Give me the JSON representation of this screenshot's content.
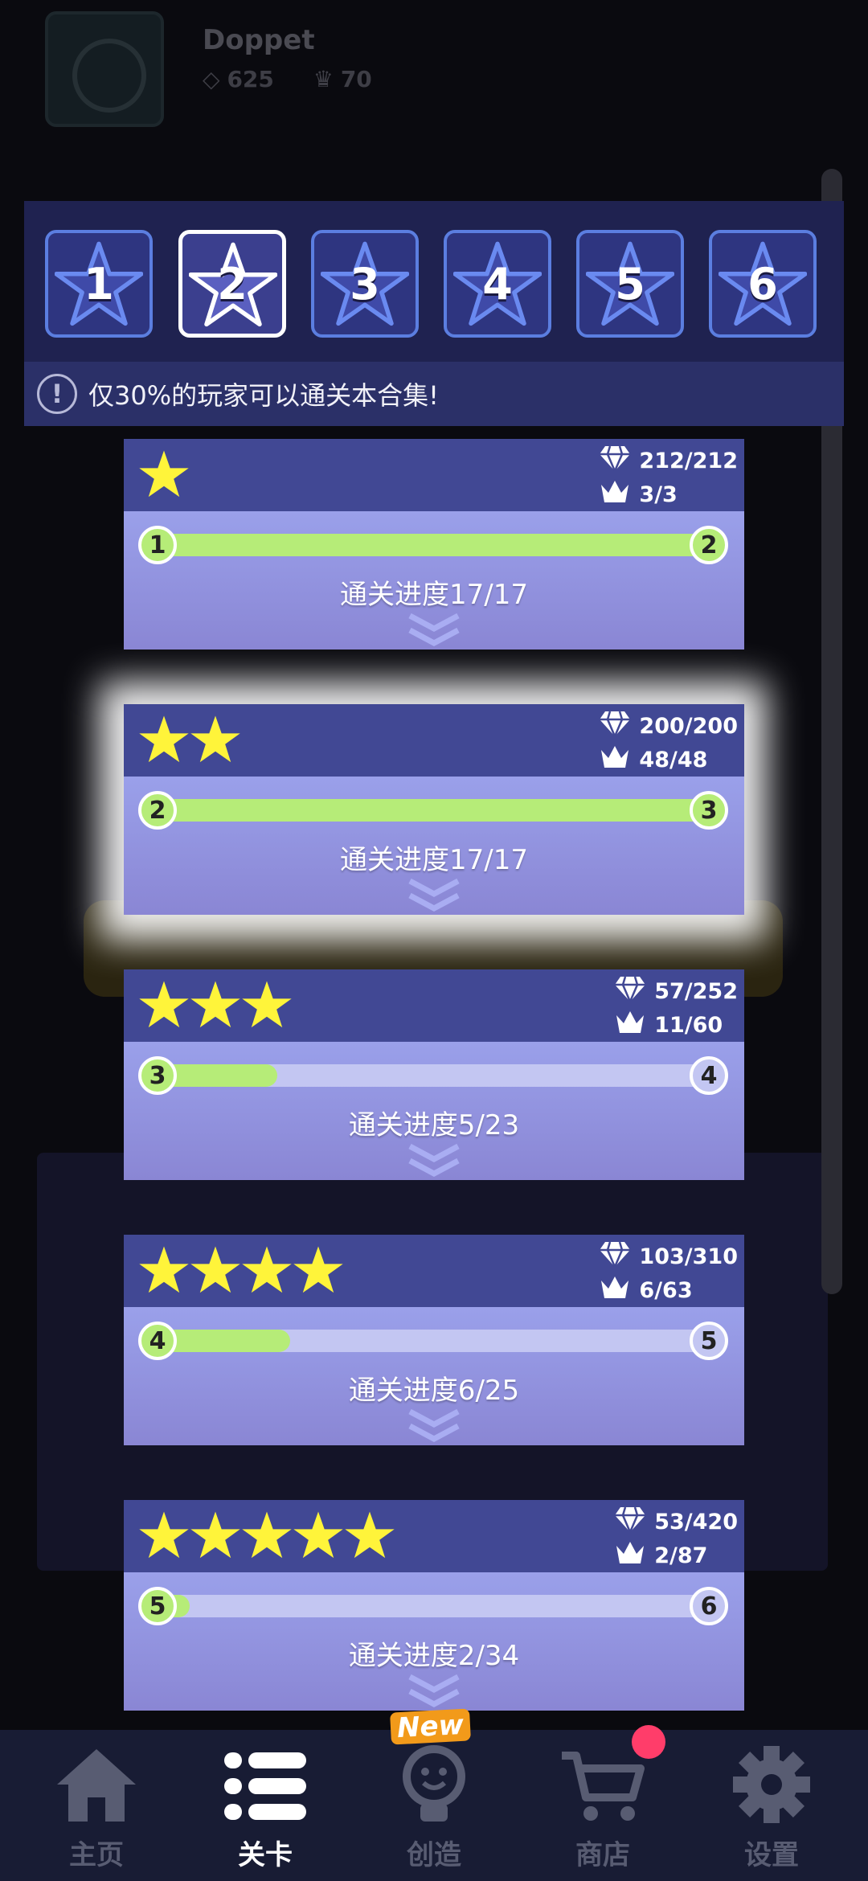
{
  "profile": {
    "name": "Doppet",
    "diamonds": "625",
    "crowns": "70"
  },
  "tabs": [
    {
      "label": "1",
      "selected": false
    },
    {
      "label": "2",
      "selected": true
    },
    {
      "label": "3",
      "selected": false
    },
    {
      "label": "4",
      "selected": false
    },
    {
      "label": "5",
      "selected": false
    },
    {
      "label": "6",
      "selected": false
    }
  ],
  "notice": {
    "icon": "!",
    "text": "仅30%的玩家可以通关本合集!"
  },
  "cards": [
    {
      "stars": 1,
      "diamonds": "212/212",
      "crowns": "3/3",
      "from": "1",
      "to": "2",
      "progress_fraction": 1.0,
      "progress_text": "通关进度17/17"
    },
    {
      "stars": 2,
      "diamonds": "200/200",
      "crowns": "48/48",
      "from": "2",
      "to": "3",
      "progress_fraction": 1.0,
      "progress_text": "通关进度17/17",
      "highlighted": true
    },
    {
      "stars": 3,
      "diamonds": "57/252",
      "crowns": "11/60",
      "from": "3",
      "to": "4",
      "progress_fraction": 0.217,
      "progress_text": "通关进度5/23"
    },
    {
      "stars": 4,
      "diamonds": "103/310",
      "crowns": "6/63",
      "from": "4",
      "to": "5",
      "progress_fraction": 0.24,
      "progress_text": "通关进度6/25"
    },
    {
      "stars": 5,
      "diamonds": "53/420",
      "crowns": "2/87",
      "from": "5",
      "to": "6",
      "progress_fraction": 0.059,
      "progress_text": "通关进度2/34"
    }
  ],
  "nav": [
    {
      "label": "主页",
      "icon": "home-icon",
      "active": false
    },
    {
      "label": "关卡",
      "icon": "list-icon",
      "active": true
    },
    {
      "label": "创造",
      "icon": "lightbulb-icon",
      "active": false
    },
    {
      "label": "商店",
      "icon": "cart-icon",
      "active": false
    },
    {
      "label": "设置",
      "icon": "gear-icon",
      "active": false
    }
  ],
  "new_badge": "New",
  "colors": {
    "panel": "#1f2250",
    "card_top": "#414894",
    "card_bottom": "#9aa0ea",
    "progress": "#b6ec78",
    "star": "#fff43a",
    "nav_bg": "#181c34"
  }
}
